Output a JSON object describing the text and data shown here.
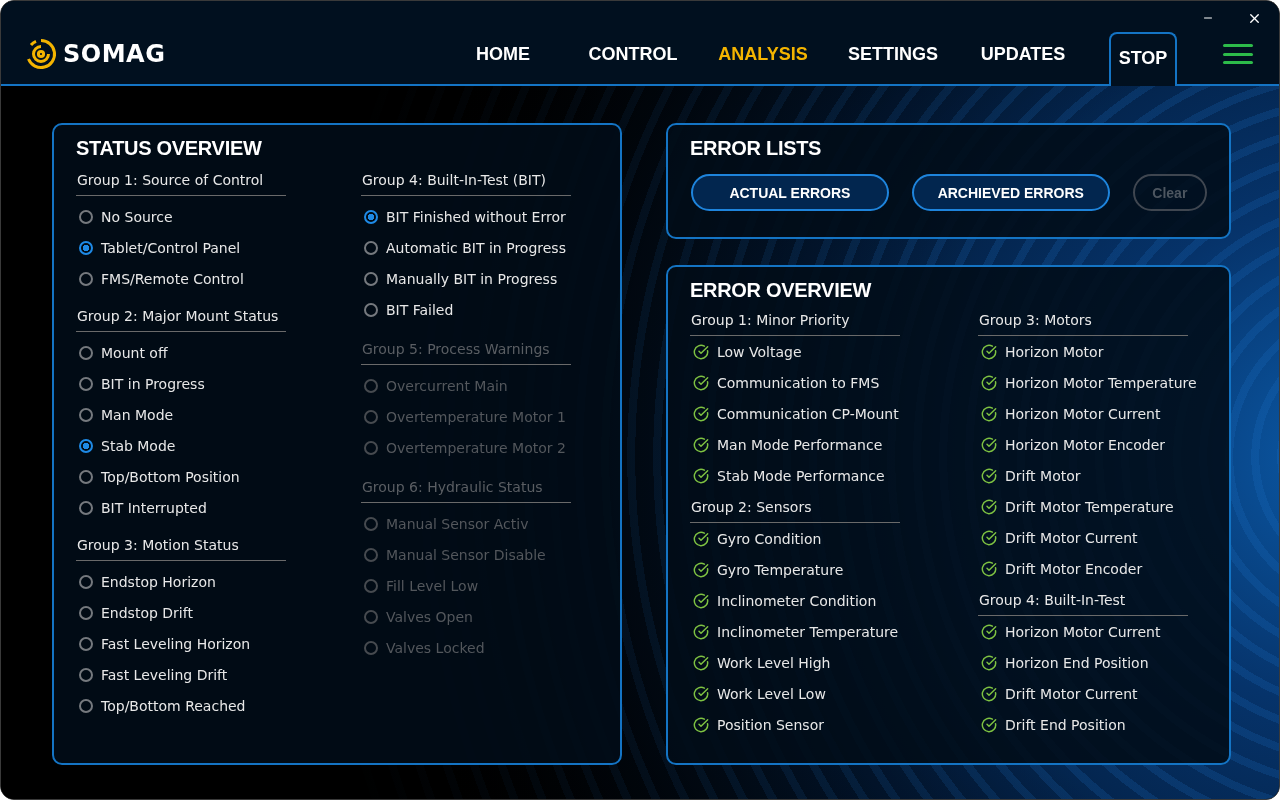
{
  "brand": "SOMAG",
  "nav": [
    {
      "label": "HOME",
      "selected": false
    },
    {
      "label": "CONTROL",
      "selected": false
    },
    {
      "label": "ANALYSIS",
      "selected": true
    },
    {
      "label": "SETTINGS",
      "selected": false
    },
    {
      "label": "UPDATES",
      "selected": false
    }
  ],
  "stop_button": "STOP",
  "status_overview": {
    "title": "STATUS OVERVIEW",
    "columns": [
      [
        {
          "heading": "Group 1: Source of Control",
          "disabled": false,
          "items": [
            {
              "label": "No Source",
              "selected": false
            },
            {
              "label": "Tablet/Control Panel",
              "selected": true
            },
            {
              "label": "FMS/Remote Control",
              "selected": false
            }
          ]
        },
        {
          "heading": "Group 2: Major Mount Status",
          "disabled": false,
          "items": [
            {
              "label": "Mount off",
              "selected": false
            },
            {
              "label": "BIT in Progress",
              "selected": false
            },
            {
              "label": "Man Mode",
              "selected": false
            },
            {
              "label": "Stab Mode",
              "selected": true
            },
            {
              "label": "Top/Bottom Position",
              "selected": false
            },
            {
              "label": "BIT Interrupted",
              "selected": false
            }
          ]
        },
        {
          "heading": "Group 3: Motion Status",
          "disabled": false,
          "items": [
            {
              "label": "Endstop Horizon",
              "selected": false
            },
            {
              "label": "Endstop Drift",
              "selected": false
            },
            {
              "label": "Fast Leveling Horizon",
              "selected": false
            },
            {
              "label": "Fast Leveling Drift",
              "selected": false
            },
            {
              "label": "Top/Bottom Reached",
              "selected": false
            }
          ]
        }
      ],
      [
        {
          "heading": "Group 4: Built-In-Test (BIT)",
          "disabled": false,
          "items": [
            {
              "label": "BIT Finished without Error",
              "selected": true
            },
            {
              "label": "Automatic BIT in Progress",
              "selected": false
            },
            {
              "label": "Manually BIT in Progress",
              "selected": false
            },
            {
              "label": "BIT Failed",
              "selected": false
            }
          ]
        },
        {
          "heading": "Group 5: Process Warnings",
          "disabled": true,
          "items": [
            {
              "label": "Overcurrent Main",
              "selected": false
            },
            {
              "label": "Overtemperature Motor 1",
              "selected": false
            },
            {
              "label": "Overtemperature Motor 2",
              "selected": false
            }
          ]
        },
        {
          "heading": "Group 6: Hydraulic Status",
          "disabled": true,
          "items": [
            {
              "label": "Manual Sensor Activ",
              "selected": false
            },
            {
              "label": "Manual Sensor Disable",
              "selected": false
            },
            {
              "label": "Fill Level Low",
              "selected": false
            },
            {
              "label": "Valves Open",
              "selected": false
            },
            {
              "label": "Valves Locked",
              "selected": false
            }
          ]
        }
      ]
    ]
  },
  "error_lists": {
    "title": "ERROR LISTS",
    "buttons": [
      {
        "label": "ACTUAL ERRORS",
        "disabled": false
      },
      {
        "label": "ARCHIEVED ERRORS",
        "disabled": false
      },
      {
        "label": "Clear",
        "disabled": true
      }
    ]
  },
  "error_overview": {
    "title": "ERROR OVERVIEW",
    "columns": [
      [
        {
          "heading": "Group 1: Minor Priority",
          "items": [
            {
              "label": "Low Voltage",
              "ok": true
            },
            {
              "label": "Communication to FMS",
              "ok": true
            },
            {
              "label": "Communication CP-Mount",
              "ok": true
            },
            {
              "label": "Man Mode Performance",
              "ok": true
            },
            {
              "label": "Stab Mode Performance",
              "ok": true
            }
          ]
        },
        {
          "heading": "Group 2: Sensors",
          "items": [
            {
              "label": "Gyro Condition",
              "ok": true
            },
            {
              "label": "Gyro Temperature",
              "ok": true
            },
            {
              "label": "Inclinometer Condition",
              "ok": true
            },
            {
              "label": "Inclinometer Temperature",
              "ok": true
            },
            {
              "label": "Work Level High",
              "ok": true
            },
            {
              "label": "Work Level Low",
              "ok": true
            },
            {
              "label": "Position Sensor",
              "ok": true
            }
          ]
        }
      ],
      [
        {
          "heading": "Group 3: Motors",
          "items": [
            {
              "label": "Horizon Motor",
              "ok": true
            },
            {
              "label": "Horizon Motor Temperature",
              "ok": true
            },
            {
              "label": "Horizon Motor Current",
              "ok": true
            },
            {
              "label": "Horizon Motor Encoder",
              "ok": true
            },
            {
              "label": "Drift Motor",
              "ok": true
            },
            {
              "label": "Drift Motor Temperature",
              "ok": true
            },
            {
              "label": "Drift Motor Current",
              "ok": true
            },
            {
              "label": "Drift Motor Encoder",
              "ok": true
            }
          ]
        },
        {
          "heading": "Group 4: Built-In-Test",
          "items": [
            {
              "label": "Horizon Motor Current",
              "ok": true
            },
            {
              "label": "Horizon End Position",
              "ok": true
            },
            {
              "label": "Drift Motor Current",
              "ok": true
            },
            {
              "label": "Drift End Position",
              "ok": true
            }
          ]
        }
      ]
    ]
  }
}
